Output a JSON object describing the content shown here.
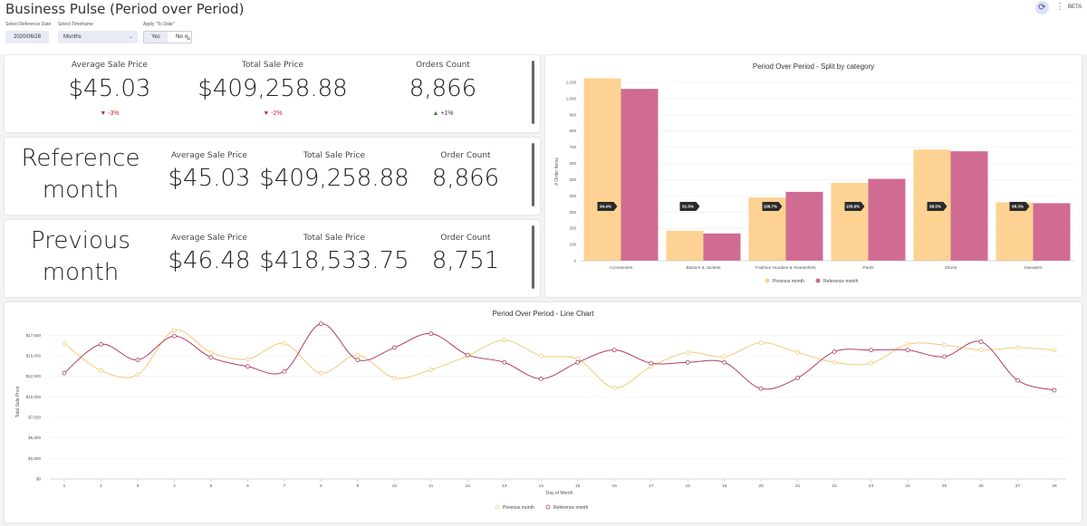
{
  "header": {
    "title": "Business Pulse (Period over Period)",
    "beta_label": "BETA",
    "refresh_icon": "refresh-icon",
    "menu_icon": "kebab-menu-icon"
  },
  "controls": {
    "reference_date_label": "Select Reference Date",
    "reference_date_value": "2020/06/28",
    "timeframe_label": "Select Timeframe",
    "timeframe_value": "Months",
    "to_date_label": "Apply \"To Date\"",
    "yes_label": "Yes",
    "no_label": "No"
  },
  "summary": {
    "kpis": [
      {
        "label": "Average Sale Price",
        "value": "$45.03",
        "delta": "-3%",
        "direction": "down"
      },
      {
        "label": "Total Sale Price",
        "value": "$409,258.88",
        "delta": "-2%",
        "direction": "down"
      },
      {
        "label": "Orders Count",
        "value": "8,866",
        "delta": "+1%",
        "direction": "up"
      }
    ]
  },
  "reference_row": {
    "title": "Reference month",
    "kpis": [
      {
        "label": "Average Sale Price",
        "value": "$45.03"
      },
      {
        "label": "Total Sale Price",
        "value": "$409,258.88"
      },
      {
        "label": "Order Count",
        "value": "8,866"
      }
    ]
  },
  "previous_row": {
    "title": "Previous month",
    "kpis": [
      {
        "label": "Average Sale Price",
        "value": "$46.48"
      },
      {
        "label": "Total Sale Price",
        "value": "$418,533.75"
      },
      {
        "label": "Order Count",
        "value": "8,751"
      }
    ]
  },
  "colors": {
    "previous": "#fdd292",
    "reference": "#d06b93",
    "previous_line": "#f6c97d",
    "reference_line": "#b23d62",
    "accent": "#3d48b0"
  },
  "chart_data": [
    {
      "type": "bar",
      "title": "Period Over Period - Split by category",
      "ylabel": "# Order Items",
      "xlabel": "",
      "ylim": [
        0,
        1100
      ],
      "yticks": [
        0,
        100,
        200,
        300,
        400,
        500,
        600,
        700,
        800,
        900,
        1000,
        1100
      ],
      "ytick_labels": [
        "0",
        "100",
        "200",
        "300",
        "400",
        "500",
        "600",
        "700",
        "800",
        "900",
        "1,000",
        "1,100"
      ],
      "categories": [
        "Accessories",
        "Blazers & Jackets",
        "Fashion Hoodies & Sweatshirts",
        "Pants",
        "Shorts",
        "Sweaters"
      ],
      "series": [
        {
          "name": "Previous month",
          "values": [
            1125,
            185,
            390,
            480,
            685,
            360
          ]
        },
        {
          "name": "Reference month",
          "values": [
            1060,
            168,
            425,
            505,
            675,
            355
          ]
        }
      ],
      "annotations": [
        "94.4%",
        "91.5%",
        "108.7%",
        "105.6%",
        "98.5%",
        "98.3%"
      ],
      "legend": "bottom-center",
      "grid": true
    },
    {
      "type": "line",
      "title": "Period Over Period - Line Chart",
      "xlabel": "Day of Month",
      "ylabel": "Total Sale Price",
      "ylim": [
        0,
        18750
      ],
      "yticks": [
        0,
        2500,
        5000,
        7500,
        10000,
        12500,
        15000,
        17500
      ],
      "ytick_labels": [
        "$0",
        "$2,500",
        "$5,000",
        "$7,500",
        "$10,000",
        "$12,500",
        "$15,000",
        "$17,500"
      ],
      "x": [
        1,
        2,
        3,
        4,
        5,
        6,
        7,
        8,
        9,
        10,
        11,
        12,
        13,
        14,
        15,
        16,
        17,
        18,
        19,
        20,
        21,
        22,
        23,
        24,
        25,
        26,
        27,
        28
      ],
      "series": [
        {
          "name": "Previous month",
          "values": [
            16500,
            13200,
            12700,
            18100,
            15400,
            14600,
            16500,
            12900,
            15100,
            12300,
            13300,
            15000,
            16900,
            15000,
            14600,
            11100,
            13700,
            15400,
            14900,
            16600,
            15400,
            14200,
            14100,
            16400,
            16300,
            15700,
            16000,
            15700
          ]
        },
        {
          "name": "Reference month",
          "values": [
            12900,
            16400,
            14500,
            17400,
            14800,
            13700,
            13100,
            18900,
            14500,
            16000,
            17700,
            15100,
            14200,
            12200,
            14200,
            15700,
            14100,
            14200,
            14200,
            11000,
            12300,
            15500,
            15700,
            15700,
            14900,
            16700,
            12000,
            10800
          ]
        }
      ],
      "legend": "bottom-center",
      "grid": true
    }
  ]
}
